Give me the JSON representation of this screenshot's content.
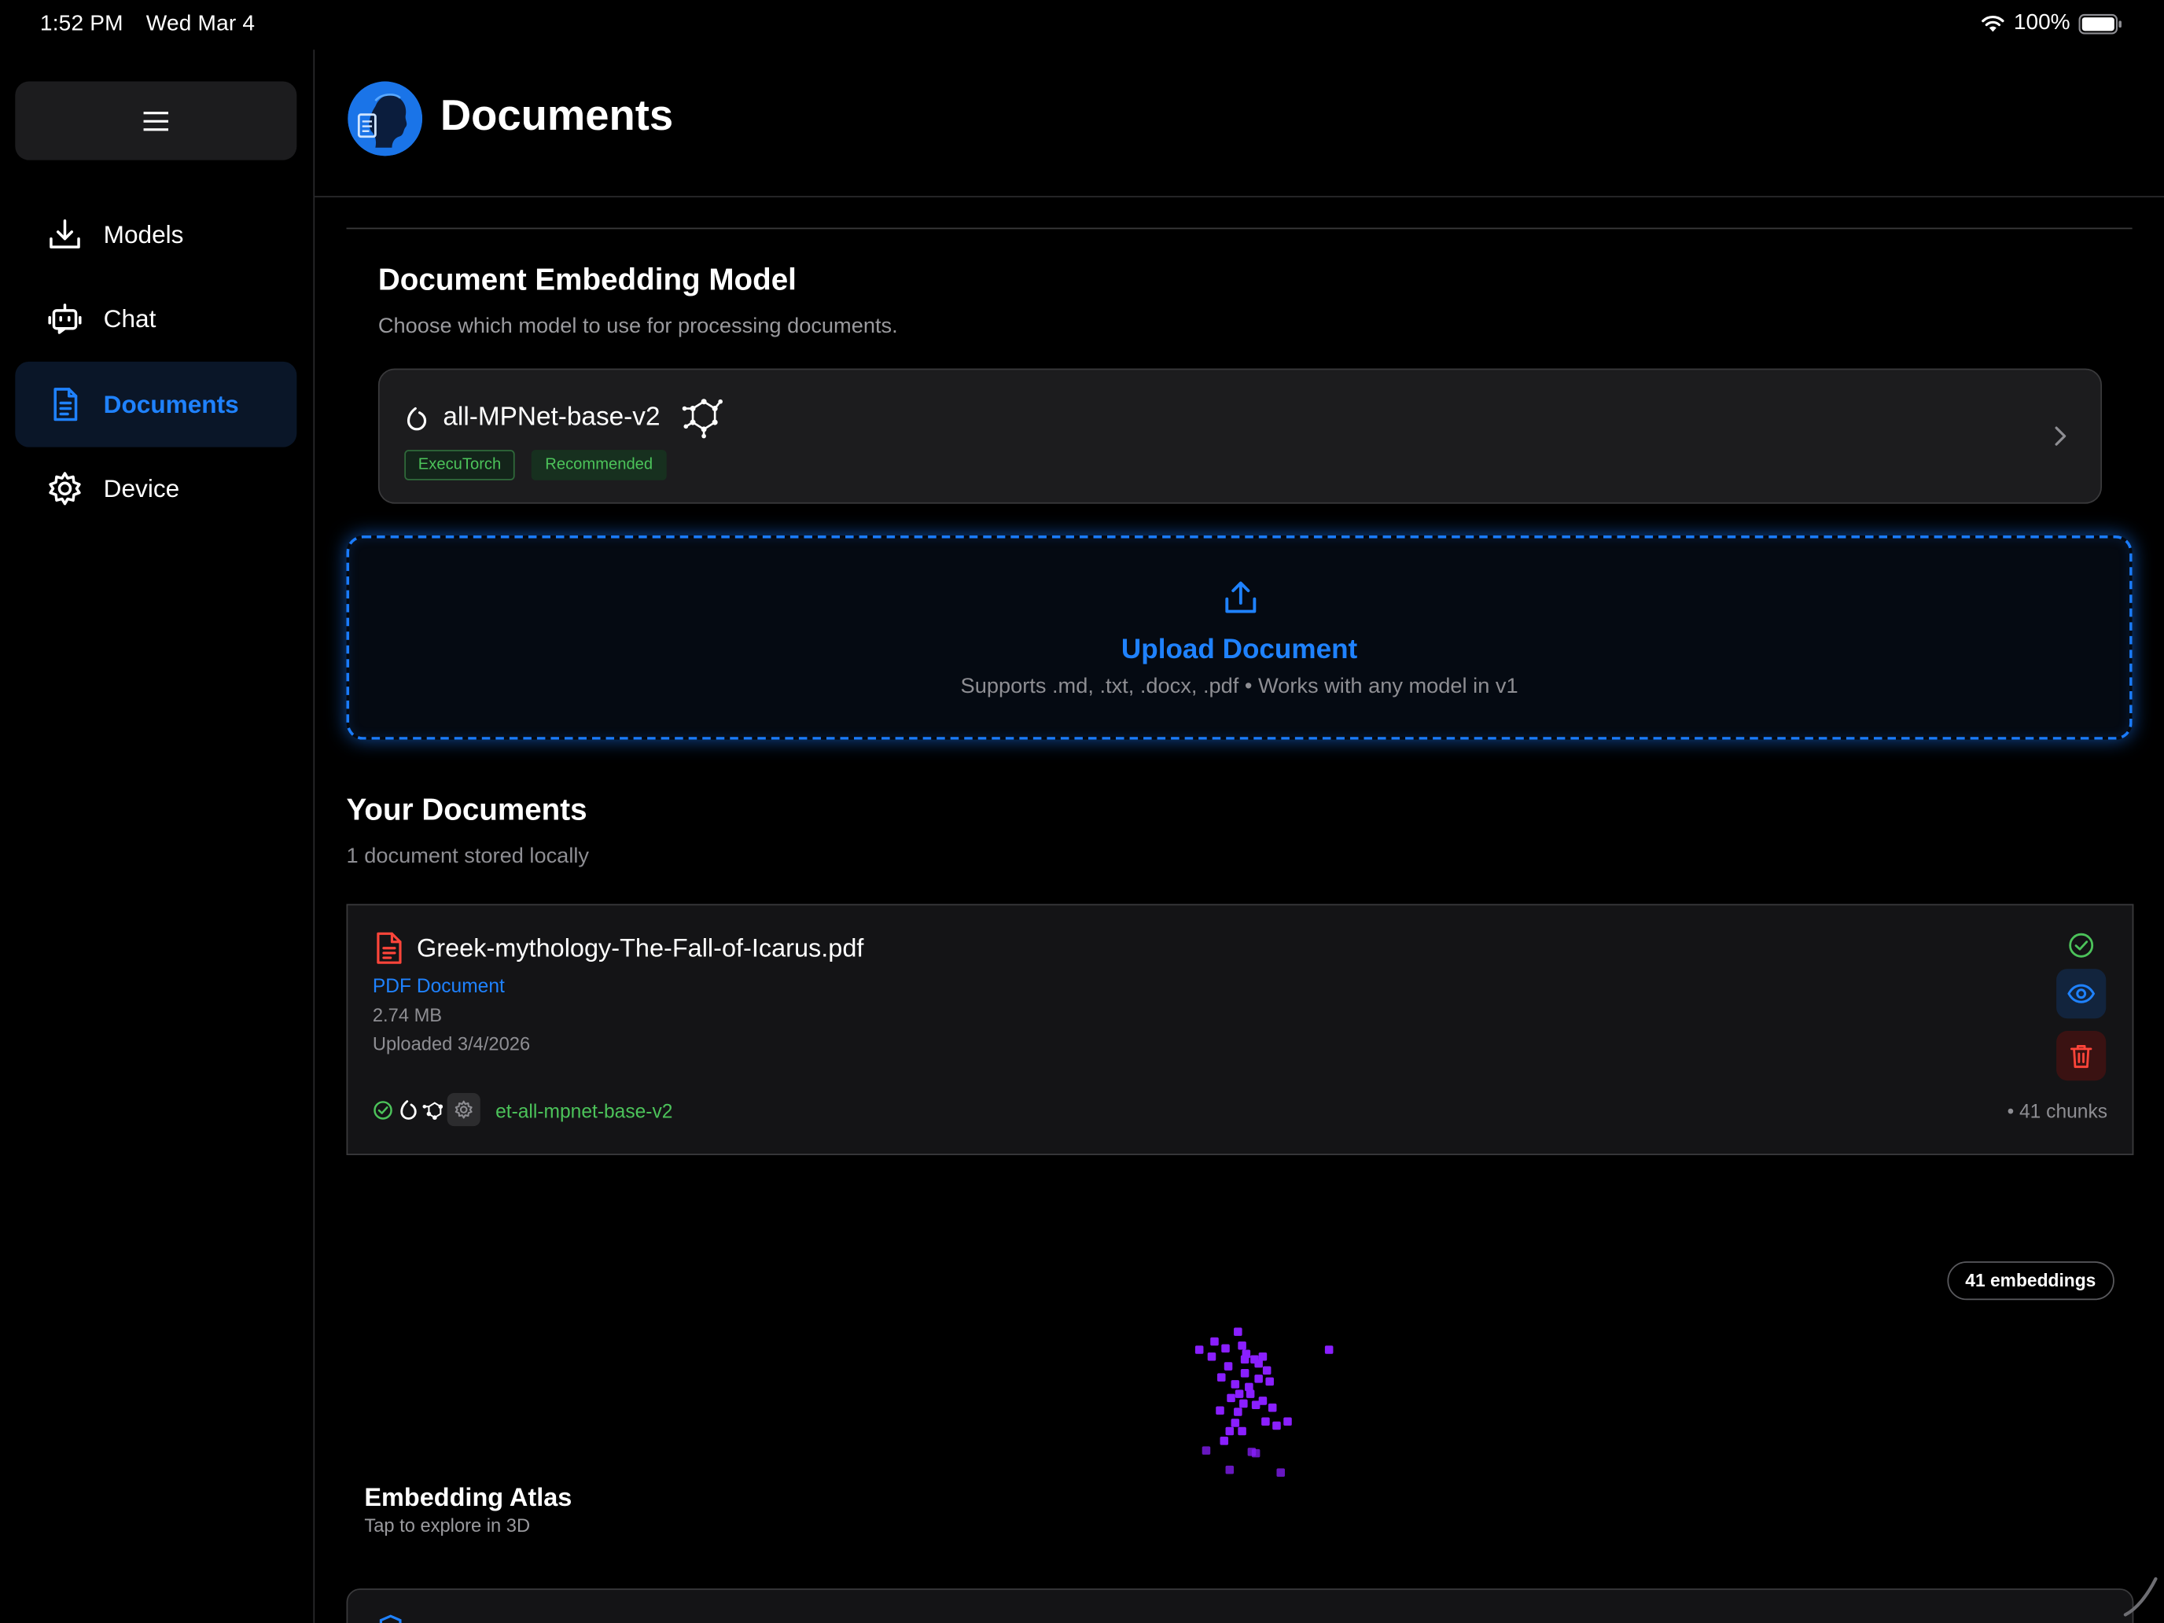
{
  "status": {
    "time": "1:52 PM",
    "date": "Wed Mar 4",
    "battery": "100%"
  },
  "sidebar": {
    "items": [
      {
        "label": "Models",
        "icon": "download-icon"
      },
      {
        "label": "Chat",
        "icon": "robot-icon"
      },
      {
        "label": "Documents",
        "icon": "document-icon",
        "active": true
      },
      {
        "label": "Device",
        "icon": "gear-icon"
      }
    ]
  },
  "header": {
    "title": "Documents"
  },
  "embedding": {
    "title": "Document Embedding Model",
    "subtitle": "Choose which model to use for processing documents.",
    "model_name": "all-MPNet-base-v2",
    "badge_runtime": "ExecuTorch",
    "badge_recommended": "Recommended"
  },
  "upload": {
    "title": "Upload Document",
    "subtitle": "Supports .md, .txt, .docx, .pdf • Works with any model in v1"
  },
  "documents": {
    "title": "Your Documents",
    "subtitle": "1 document stored locally",
    "items": [
      {
        "name": "Greek-mythology-The-Fall-of-Icarus.pdf",
        "type": "PDF Document",
        "size": "2.74 MB",
        "uploaded": "Uploaded 3/4/2026",
        "model": "et-all-mpnet-base-v2",
        "chunks": "• 41 chunks"
      }
    ]
  },
  "atlas": {
    "badge": "41 embeddings",
    "title": "Embedding Atlas",
    "subtitle": "Tap to explore in 3D",
    "point_color": "#8a1fff"
  },
  "colors": {
    "accent": "#1f82ff",
    "success": "#4cc35a",
    "danger": "#ff453a"
  }
}
